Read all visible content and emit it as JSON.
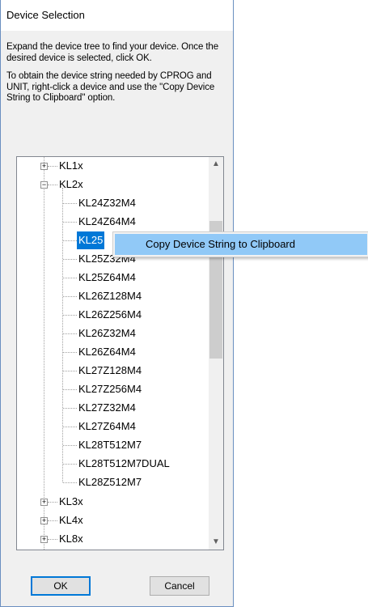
{
  "dialog": {
    "title": "Device Selection",
    "instructions_1": "Expand the device tree to find your device. Once the desired device is selected, click OK.",
    "instructions_2": "To obtain the device string needed by CPROG and UNIT, right-click a device and use the \"Copy Device String to Clipboard\" option."
  },
  "tree": {
    "families": [
      {
        "label": "KL1x",
        "expander": "+"
      },
      {
        "label": "KL2x",
        "expander": "−"
      }
    ],
    "kl2x_devices": [
      "KL24Z32M4",
      "KL24Z64M4",
      "KL25",
      "KL25Z32M4",
      "KL25Z64M4",
      "KL26Z128M4",
      "KL26Z256M4",
      "KL26Z32M4",
      "KL26Z64M4",
      "KL27Z128M4",
      "KL27Z256M4",
      "KL27Z32M4",
      "KL27Z64M4",
      "KL28T512M7",
      "KL28T512M7DUAL",
      "KL28Z512M7"
    ],
    "selected_label": "KL25",
    "more_families": [
      {
        "label": "KL3x",
        "expander": "+"
      },
      {
        "label": "KL4x",
        "expander": "+"
      },
      {
        "label": "KL8x",
        "expander": "+"
      }
    ]
  },
  "context_menu": {
    "item": "Copy Device String to Clipboard"
  },
  "buttons": {
    "ok": "OK",
    "cancel": "Cancel"
  },
  "scroll": {
    "up": "▲",
    "down": "▼"
  },
  "colors": {
    "selection": "#0078d7",
    "menu_highlight": "#91c9f7"
  }
}
